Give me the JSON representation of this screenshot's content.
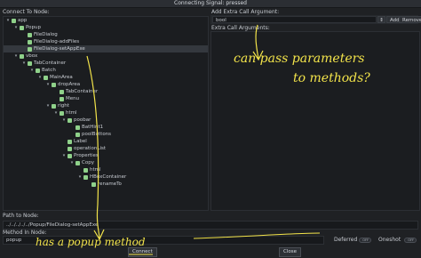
{
  "window": {
    "title": "Connecting Signal: pressed"
  },
  "left": {
    "label": "Connect To Node:",
    "tree": [
      {
        "indent": 0,
        "arrow": "v",
        "icon_color": "#8fd18a",
        "label": "app"
      },
      {
        "indent": 1,
        "arrow": "v",
        "icon_color": "#8fd18a",
        "label": "Popup"
      },
      {
        "indent": 2,
        "arrow": "",
        "icon_color": "#8fd18a",
        "label": "FileDialog"
      },
      {
        "indent": 2,
        "arrow": "",
        "icon_color": "#8fd18a",
        "label": "FileDialog-addFiles"
      },
      {
        "indent": 2,
        "arrow": "",
        "icon_color": "#8fd18a",
        "label": "FileDialog-setAppExe",
        "selected": true
      },
      {
        "indent": 1,
        "arrow": "v",
        "icon_color": "#8fd18a",
        "label": "vbox"
      },
      {
        "indent": 2,
        "arrow": "v",
        "icon_color": "#8fd18a",
        "label": "TabContainer"
      },
      {
        "indent": 3,
        "arrow": "v",
        "icon_color": "#8fd18a",
        "label": "Batch"
      },
      {
        "indent": 4,
        "arrow": "v",
        "icon_color": "#8fd18a",
        "label": "MainArea"
      },
      {
        "indent": 5,
        "arrow": "v",
        "icon_color": "#8fd18a",
        "label": "dropArea"
      },
      {
        "indent": 6,
        "arrow": "",
        "icon_color": "#8fd18a",
        "label": "TabContainer"
      },
      {
        "indent": 6,
        "arrow": "",
        "icon_color": "#8fd18a",
        "label": "Menu"
      },
      {
        "indent": 5,
        "arrow": "v",
        "icon_color": "#8fd18a",
        "label": "right"
      },
      {
        "indent": 6,
        "arrow": "v",
        "icon_color": "#8fd18a",
        "label": "html"
      },
      {
        "indent": 7,
        "arrow": "v",
        "icon_color": "#8fd18a",
        "label": "poobar"
      },
      {
        "indent": 8,
        "arrow": "",
        "icon_color": "#8fd18a",
        "label": "BatHint1"
      },
      {
        "indent": 8,
        "arrow": "",
        "icon_color": "#8fd18a",
        "label": "poolButtons"
      },
      {
        "indent": 7,
        "arrow": "",
        "icon_color": "#8fd18a",
        "label": "Label"
      },
      {
        "indent": 7,
        "arrow": "",
        "icon_color": "#8fd18a",
        "label": "operationList"
      },
      {
        "indent": 7,
        "arrow": "v",
        "icon_color": "#8fd18a",
        "label": "Properties"
      },
      {
        "indent": 8,
        "arrow": "v",
        "icon_color": "#8fd18a",
        "label": "Copy"
      },
      {
        "indent": 9,
        "arrow": "",
        "icon_color": "#8fd18a",
        "label": "html"
      },
      {
        "indent": 9,
        "arrow": "v",
        "icon_color": "#8fd18a",
        "label": "HBoxContainer"
      },
      {
        "indent": 10,
        "arrow": "",
        "icon_color": "#8fd18a",
        "label": "renameTo"
      }
    ]
  },
  "right": {
    "add_arg_label": "Add Extra Call Argument:",
    "arg_type_value": "bool",
    "add_button": "Add",
    "remove_button": "Remove",
    "extra_args_label": "Extra Call Arguments:"
  },
  "bottom": {
    "path_label": "Path to Node:",
    "path_value": "../../../../../Popup/FileDialog-setAppExe",
    "method_label": "Method In Node:",
    "method_value": "popup",
    "deferred_label": "Deferred",
    "deferred_state": "OFF",
    "oneshot_label": "Oneshot",
    "oneshot_state": "OFF",
    "connect_button": "Connect",
    "close_button": "Close"
  },
  "annotations": {
    "note1_line1": "can pass parameters",
    "note1_line2": "to methods?",
    "note2": "has a popup method"
  },
  "colors": {
    "annotation": "#f2e34a",
    "background": "#1f2124"
  }
}
